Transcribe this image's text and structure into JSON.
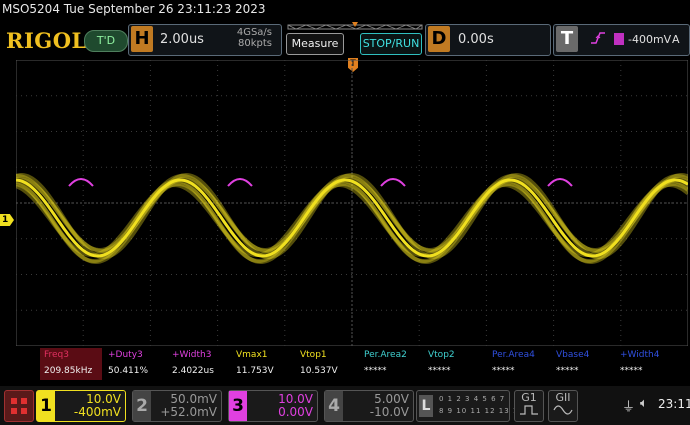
{
  "title_bar": {
    "text": "MSO5204  Tue September 26 23:11:23 2023"
  },
  "top": {
    "brand": "RIGOL",
    "td_label": "T'D",
    "h_label": "H",
    "timebase": "2.00us",
    "sample_rate": "4GSa/s",
    "memory_depth": "80kpts",
    "measure_label": "Measure",
    "stop_run_label": "STOP/RUN",
    "d_label": "D",
    "delay": "0.00s",
    "t_label": "T",
    "trigger_level": "-400mV",
    "trigger_mode": "A",
    "trigger_channel_marker": "1"
  },
  "markers": {
    "trigger_pos": "T",
    "ch1": "1"
  },
  "measurements": [
    {
      "label": "Freq3",
      "value": "209.85kHz",
      "color": "#e03060",
      "highlight": true
    },
    {
      "label": "+Duty3",
      "value": "50.411%",
      "color": "#e040e0"
    },
    {
      "label": "+Width3",
      "value": "2.4022us",
      "color": "#e040e0"
    },
    {
      "label": "Vmax1",
      "value": "11.753V",
      "color": "#f0e020"
    },
    {
      "label": "Vtop1",
      "value": "10.537V",
      "color": "#f0e020"
    },
    {
      "label": "Per.Area2",
      "value": "*****",
      "color": "#40d0d0"
    },
    {
      "label": "Vtop2",
      "value": "*****",
      "color": "#40d0d0"
    },
    {
      "label": "Per.Area4",
      "value": "*****",
      "color": "#3050e0"
    },
    {
      "label": "Vbase4",
      "value": "*****",
      "color": "#3050e0"
    },
    {
      "label": "+Width4",
      "value": "*****",
      "color": "#3050e0"
    }
  ],
  "channels": [
    {
      "num": "1",
      "scale": "10.0V",
      "offset": "-400mV",
      "color": "#f0e020",
      "active": true
    },
    {
      "num": "2",
      "scale": "50.0mV",
      "offset": "+52.0mV",
      "color": "#888888",
      "active": false
    },
    {
      "num": "3",
      "scale": "10.0V",
      "offset": "0.00V",
      "color": "#e040e0",
      "active": true
    },
    {
      "num": "4",
      "scale": "5.00V",
      "offset": "-10.0V",
      "color": "#888888",
      "active": false
    }
  ],
  "logic": {
    "label": "L",
    "row1": "0 1 2 3 4 5 6 7",
    "row2": "8 9 10 11 12 13 14 15"
  },
  "generators": [
    {
      "label": "G1"
    },
    {
      "label": "GII"
    }
  ],
  "status": {
    "time": "23:11"
  },
  "waveform": {
    "channel": "1",
    "shape": "sine",
    "cycles_visible": 5,
    "color": "#f0e020",
    "ref_color": "#e040e0"
  }
}
